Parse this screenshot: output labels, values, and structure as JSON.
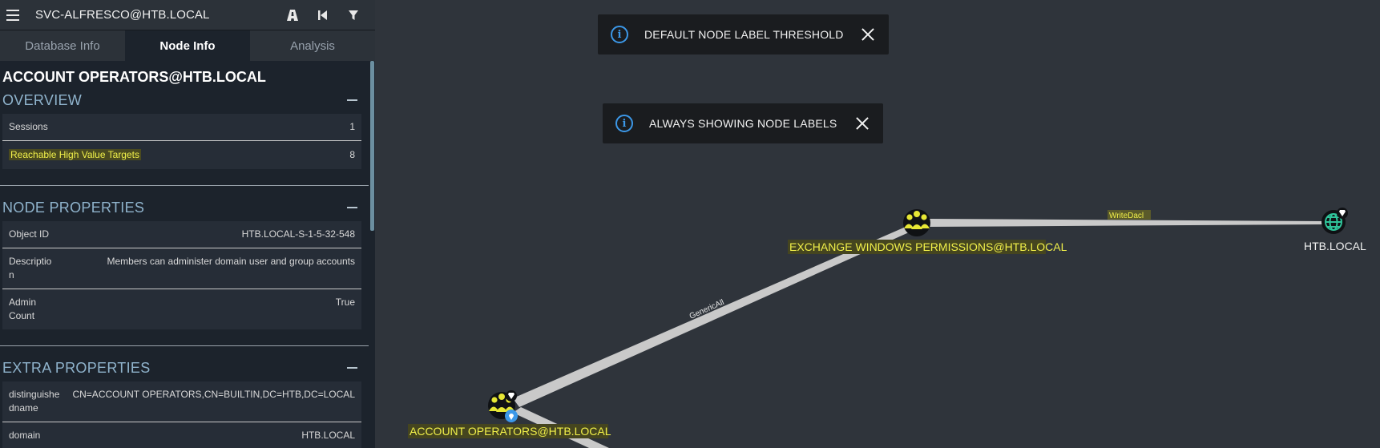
{
  "header": {
    "title": "SVC-ALFRESCO@HTB.LOCAL",
    "menu_icon": "hamburger-icon",
    "buttons": [
      "pathfinding-icon",
      "back-icon",
      "filter-icon"
    ]
  },
  "tabs": [
    {
      "label": "Database Info",
      "active": false
    },
    {
      "label": "Node Info",
      "active": true
    },
    {
      "label": "Analysis",
      "active": false
    }
  ],
  "node": {
    "title": "ACCOUNT OPERATORS@HTB.LOCAL",
    "overview": {
      "heading": "OVERVIEW",
      "rows": [
        {
          "key": "Sessions",
          "value": "1"
        },
        {
          "key": "Reachable High Value Targets",
          "value": "8"
        }
      ]
    },
    "node_properties": {
      "heading": "NODE PROPERTIES",
      "rows": [
        {
          "key": "Object ID",
          "value": "HTB.LOCAL-S-1-5-32-548"
        },
        {
          "key": "Description",
          "value": "Members can administer domain user and group accounts"
        },
        {
          "key": "Admin Count",
          "value": "True"
        }
      ]
    },
    "extra_properties": {
      "heading": "EXTRA PROPERTIES",
      "rows": [
        {
          "key": "distinguishedname",
          "value": "CN=ACCOUNT OPERATORS,CN=BUILTIN,DC=HTB,DC=LOCAL"
        },
        {
          "key": "domain",
          "value": "HTB.LOCAL"
        }
      ]
    }
  },
  "toasts": [
    {
      "message": "DEFAULT NODE LABEL THRESHOLD"
    },
    {
      "message": "ALWAYS SHOWING NODE LABELS"
    }
  ],
  "graph": {
    "nodes": [
      {
        "label": "EXCHANGE WINDOWS PERMISSIONS@HTB.LOCAL",
        "type": "group",
        "highlighted": true
      },
      {
        "label": "HTB.LOCAL",
        "type": "domain",
        "highlighted": false
      },
      {
        "label": "ACCOUNT OPERATORS@HTB.LOCAL",
        "type": "group",
        "highlighted": true
      }
    ],
    "edges": [
      {
        "label": "WriteDacl",
        "highlighted": true
      },
      {
        "label": "GenericAll",
        "highlighted": false
      }
    ]
  },
  "colors": {
    "background": "#2f343b",
    "sidebar": "#1c232c",
    "highlight_text": "#f1f04a",
    "group_node": "#e6e635",
    "domain_node": "#2fc49a",
    "info_accent": "#3c98e8"
  }
}
